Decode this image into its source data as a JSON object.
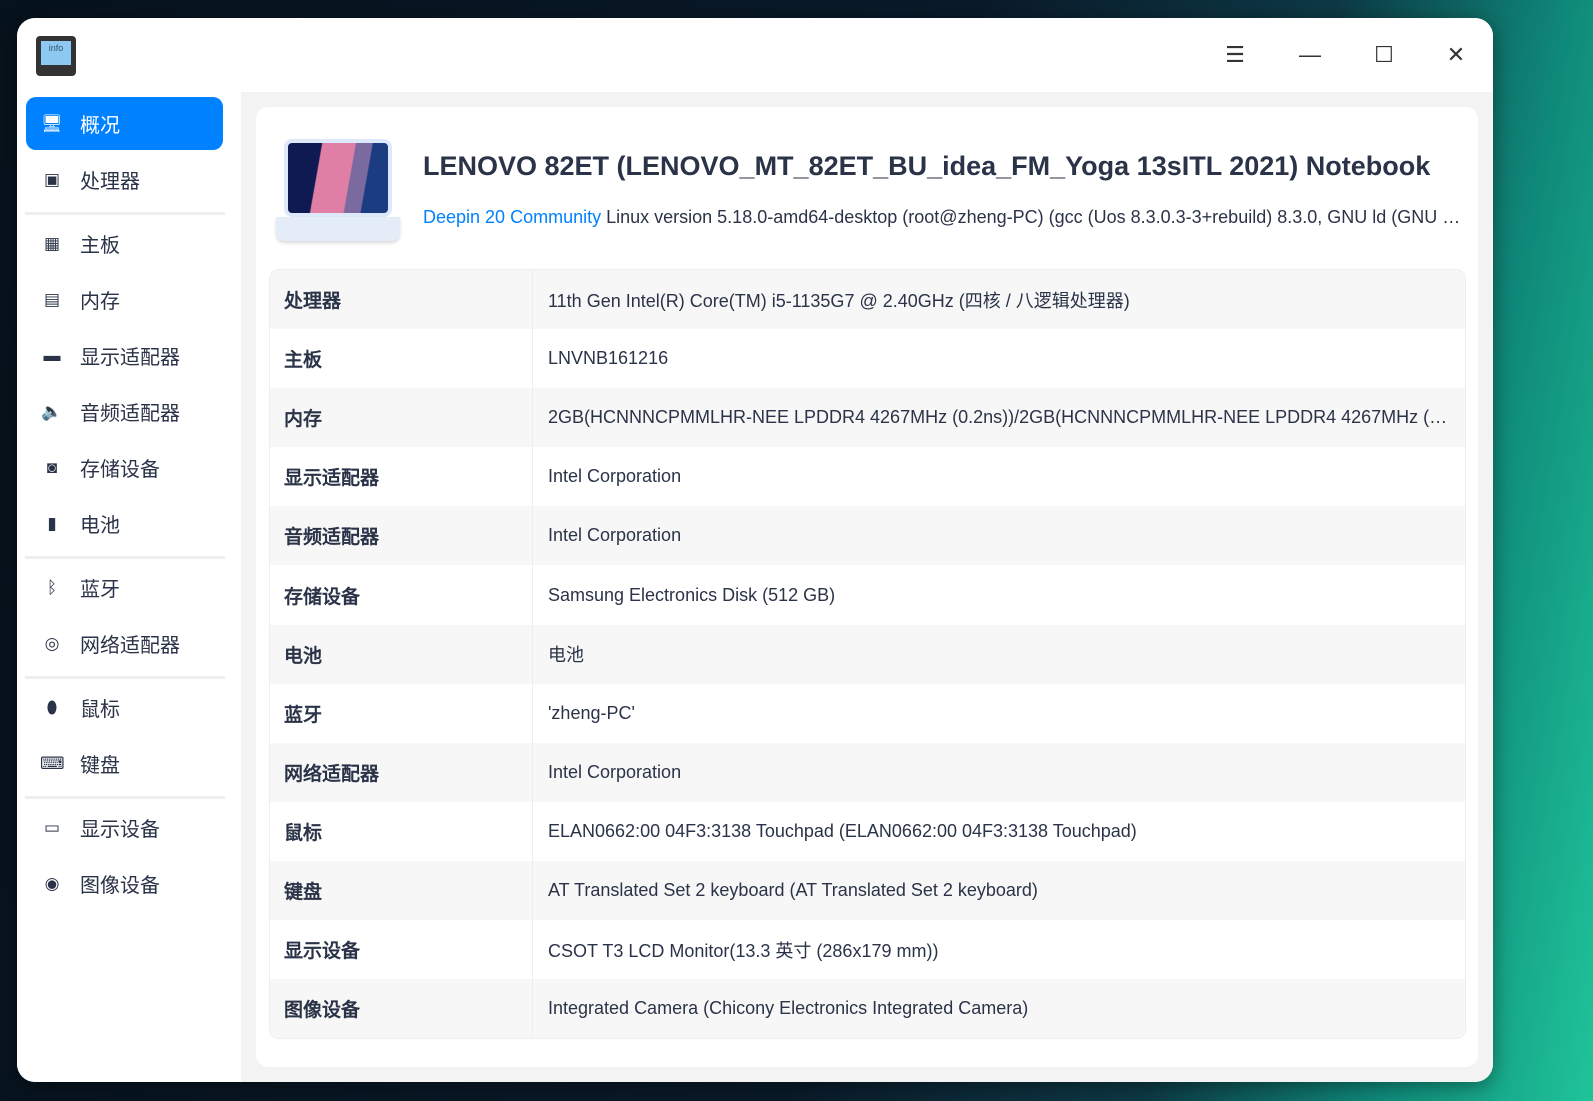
{
  "window": {
    "app_icon_text": "info",
    "menu_icon": "menu-icon",
    "minimize_icon": "minimize-icon",
    "maximize_icon": "maximize-icon",
    "close_icon": "close-icon"
  },
  "sidebar": {
    "items": [
      {
        "label": "概况",
        "icon": "overview-icon",
        "active": true
      },
      {
        "label": "处理器",
        "icon": "cpu-icon"
      },
      {
        "label": "主板",
        "icon": "motherboard-icon"
      },
      {
        "label": "内存",
        "icon": "memory-icon"
      },
      {
        "label": "显示适配器",
        "icon": "display-adapter-icon"
      },
      {
        "label": "音频适配器",
        "icon": "speaker-icon"
      },
      {
        "label": "存储设备",
        "icon": "storage-icon"
      },
      {
        "label": "电池",
        "icon": "battery-icon"
      },
      {
        "label": "蓝牙",
        "icon": "bluetooth-icon"
      },
      {
        "label": "网络适配器",
        "icon": "network-icon"
      },
      {
        "label": "鼠标",
        "icon": "mouse-icon"
      },
      {
        "label": "键盘",
        "icon": "keyboard-icon"
      },
      {
        "label": "显示设备",
        "icon": "monitor-icon"
      },
      {
        "label": "图像设备",
        "icon": "camera-icon"
      }
    ]
  },
  "overview": {
    "title": "LENOVO 82ET (LENOVO_MT_82ET_BU_idea_FM_Yoga 13sITL 2021) Notebook",
    "os_link": "Deepin 20 Community",
    "kernel": "Linux version 5.18.0-amd64-desktop (root@zheng-PC) (gcc (Uos 8.3.0.3-3+rebuild) 8.3.0, GNU ld (GNU …",
    "rows": [
      {
        "k": "处理器",
        "v": "11th Gen Intel(R) Core(TM) i5-1135G7 @ 2.40GHz (四核 / 八逻辑处理器)"
      },
      {
        "k": "主板",
        "v": "LNVNB161216"
      },
      {
        "k": "内存",
        "v": "2GB(HCNNNCPMMLHR-NEE LPDDR4 4267MHz (0.2ns))/2GB(HCNNNCPMMLHR-NEE LPDDR4 4267MHz (0.2ns)…"
      },
      {
        "k": "显示适配器",
        "v": "Intel Corporation"
      },
      {
        "k": "音频适配器",
        "v": "Intel Corporation"
      },
      {
        "k": "存储设备",
        "v": "Samsung Electronics Disk (512 GB)"
      },
      {
        "k": "电池",
        "v": "电池"
      },
      {
        "k": "蓝牙",
        "v": "'zheng-PC'"
      },
      {
        "k": "网络适配器",
        "v": "Intel Corporation"
      },
      {
        "k": "鼠标",
        "v": "ELAN0662:00 04F3:3138 Touchpad (ELAN0662:00 04F3:3138 Touchpad)"
      },
      {
        "k": "键盘",
        "v": "AT Translated Set 2 keyboard (AT Translated Set 2 keyboard)"
      },
      {
        "k": "显示设备",
        "v": "CSOT T3 LCD Monitor(13.3 英寸 (286x179 mm))"
      },
      {
        "k": "图像设备",
        "v": "Integrated Camera (Chicony Electronics Integrated Camera)"
      }
    ]
  }
}
